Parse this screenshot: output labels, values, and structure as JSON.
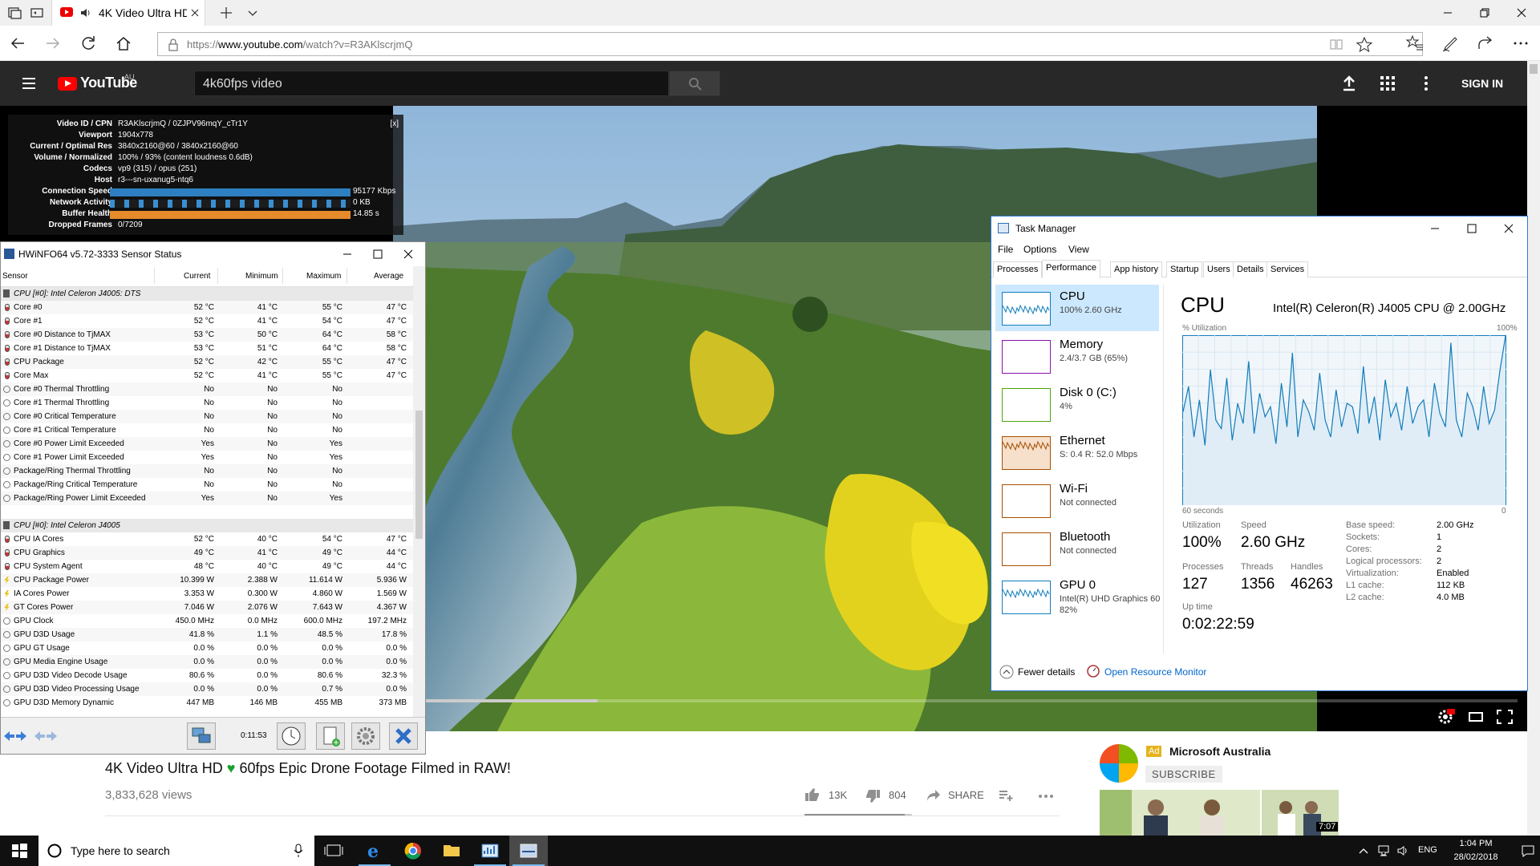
{
  "browser": {
    "tab_title": "4K Video Ultra HD ·",
    "url_prefix": "https://",
    "url_domain": "www.youtube.com",
    "url_path": "/watch?v=R3AKlscrjmQ"
  },
  "youtube": {
    "logo": "YouTube",
    "region": "AU",
    "search_value": "4k60fps video",
    "sign_in": "SIGN IN",
    "video_title_1": "4K Video Ultra HD",
    "video_title_heart": "♥",
    "video_title_2": "60fps Epic Drone Footage Filmed in RAW!",
    "views": "3,833,628 views",
    "likes": "13K",
    "dislikes": "804",
    "share": "SHARE",
    "ad_badge": "Ad",
    "ad_channel": "Microsoft Australia",
    "subscribe": "SUBSCRIBE",
    "thumb_duration": "7:07",
    "watched_fraction": 0.003,
    "buffered_fraction": 0.39
  },
  "nerd_stats": {
    "close": "[x]",
    "rows": [
      {
        "key": "Video ID / CPN",
        "value": "R3AKlscrjmQ / 0ZJPV96mqY_cTr1Y"
      },
      {
        "key": "Viewport",
        "value": "1904x778"
      },
      {
        "key": "Current / Optimal Res",
        "value": "3840x2160@60 / 3840x2160@60"
      },
      {
        "key": "Volume / Normalized",
        "value": "100% / 93% (content loudness 0.6dB)"
      },
      {
        "key": "Codecs",
        "value": "vp9 (315) / opus (251)"
      },
      {
        "key": "Host",
        "value": "r3---sn-uxanug5-ntq6"
      },
      {
        "key": "Connection Speed",
        "value": "95177 Kbps"
      },
      {
        "key": "Network Activity",
        "value": "0 KB"
      },
      {
        "key": "Buffer Health",
        "value": "14.85 s"
      },
      {
        "key": "Dropped Frames",
        "value": "0/7209"
      }
    ]
  },
  "hwinfo": {
    "title": "HWiNFO64 v5.72-3333 Sensor Status",
    "columns": [
      "Sensor",
      "Current",
      "Minimum",
      "Maximum",
      "Average"
    ],
    "rows": [
      {
        "type": "grp",
        "name": "CPU [#0]: Intel Celeron J4005: DTS"
      },
      {
        "type": "therm",
        "name": "Core #0",
        "cur": "52 °C",
        "min": "41 °C",
        "max": "55 °C",
        "avg": "47 °C"
      },
      {
        "type": "therm",
        "name": "Core #1",
        "cur": "52 °C",
        "min": "41 °C",
        "max": "54 °C",
        "avg": "47 °C"
      },
      {
        "type": "therm",
        "name": "Core #0 Distance to TjMAX",
        "cur": "53 °C",
        "min": "50 °C",
        "max": "64 °C",
        "avg": "58 °C"
      },
      {
        "type": "therm",
        "name": "Core #1 Distance to TjMAX",
        "cur": "53 °C",
        "min": "51 °C",
        "max": "64 °C",
        "avg": "58 °C"
      },
      {
        "type": "therm",
        "name": "CPU Package",
        "cur": "52 °C",
        "min": "42 °C",
        "max": "55 °C",
        "avg": "47 °C"
      },
      {
        "type": "therm",
        "name": "Core Max",
        "cur": "52 °C",
        "min": "41 °C",
        "max": "55 °C",
        "avg": "47 °C"
      },
      {
        "type": "clock",
        "name": "Core #0 Thermal Throttling",
        "cur": "No",
        "min": "No",
        "max": "No",
        "avg": ""
      },
      {
        "type": "clock",
        "name": "Core #1 Thermal Throttling",
        "cur": "No",
        "min": "No",
        "max": "No",
        "avg": ""
      },
      {
        "type": "clock",
        "name": "Core #0 Critical Temperature",
        "cur": "No",
        "min": "No",
        "max": "No",
        "avg": ""
      },
      {
        "type": "clock",
        "name": "Core #1 Critical Temperature",
        "cur": "No",
        "min": "No",
        "max": "No",
        "avg": ""
      },
      {
        "type": "clock",
        "name": "Core #0 Power Limit Exceeded",
        "cur": "Yes",
        "min": "No",
        "max": "Yes",
        "avg": ""
      },
      {
        "type": "clock",
        "name": "Core #1 Power Limit Exceeded",
        "cur": "Yes",
        "min": "No",
        "max": "Yes",
        "avg": ""
      },
      {
        "type": "clock",
        "name": "Package/Ring Thermal Throttling",
        "cur": "No",
        "min": "No",
        "max": "No",
        "avg": ""
      },
      {
        "type": "clock",
        "name": "Package/Ring Critical Temperature",
        "cur": "No",
        "min": "No",
        "max": "No",
        "avg": ""
      },
      {
        "type": "clock",
        "name": "Package/Ring Power Limit Exceeded",
        "cur": "Yes",
        "min": "No",
        "max": "Yes",
        "avg": ""
      },
      {
        "type": "blank",
        "name": ""
      },
      {
        "type": "grp",
        "name": "CPU [#0]: Intel Celeron J4005"
      },
      {
        "type": "therm",
        "name": "CPU IA Cores",
        "cur": "52 °C",
        "min": "40 °C",
        "max": "54 °C",
        "avg": "47 °C"
      },
      {
        "type": "therm",
        "name": "CPU Graphics",
        "cur": "49 °C",
        "min": "41 °C",
        "max": "49 °C",
        "avg": "44 °C"
      },
      {
        "type": "therm",
        "name": "CPU System Agent",
        "cur": "48 °C",
        "min": "40 °C",
        "max": "49 °C",
        "avg": "44 °C"
      },
      {
        "type": "bolt",
        "name": "CPU Package Power",
        "cur": "10.399 W",
        "min": "2.388 W",
        "max": "11.614 W",
        "avg": "5.936 W"
      },
      {
        "type": "bolt",
        "name": "IA Cores Power",
        "cur": "3.353 W",
        "min": "0.300 W",
        "max": "4.860 W",
        "avg": "1.569 W"
      },
      {
        "type": "bolt",
        "name": "GT Cores Power",
        "cur": "7.046 W",
        "min": "2.076 W",
        "max": "7.643 W",
        "avg": "4.367 W"
      },
      {
        "type": "clock",
        "name": "GPU Clock",
        "cur": "450.0 MHz",
        "min": "0.0 MHz",
        "max": "600.0 MHz",
        "avg": "197.2 MHz"
      },
      {
        "type": "clock",
        "name": "GPU D3D Usage",
        "cur": "41.8 %",
        "min": "1.1 %",
        "max": "48.5 %",
        "avg": "17.8 %"
      },
      {
        "type": "clock",
        "name": "GPU GT Usage",
        "cur": "0.0 %",
        "min": "0.0 %",
        "max": "0.0 %",
        "avg": "0.0 %"
      },
      {
        "type": "clock",
        "name": "GPU Media Engine Usage",
        "cur": "0.0 %",
        "min": "0.0 %",
        "max": "0.0 %",
        "avg": "0.0 %"
      },
      {
        "type": "clock",
        "name": "GPU D3D Video Decode Usage",
        "cur": "80.6 %",
        "min": "0.0 %",
        "max": "80.6 %",
        "avg": "32.3 %"
      },
      {
        "type": "clock",
        "name": "GPU D3D Video Processing Usage",
        "cur": "0.0 %",
        "min": "0.0 %",
        "max": "0.7 %",
        "avg": "0.0 %"
      },
      {
        "type": "clock",
        "name": "GPU D3D Memory Dynamic",
        "cur": "447 MB",
        "min": "146 MB",
        "max": "455 MB",
        "avg": "373 MB"
      }
    ],
    "timer": "0:11:53"
  },
  "taskmgr": {
    "title": "Task Manager",
    "menu": [
      "File",
      "Options",
      "View"
    ],
    "tabs": [
      "Processes",
      "Performance",
      "App history",
      "Startup",
      "Users",
      "Details",
      "Services"
    ],
    "resources": [
      {
        "name": "CPU",
        "val": "100%  2.60 GHz",
        "val2": "",
        "color": "#117dbb"
      },
      {
        "name": "Memory",
        "val": "2.4/3.7 GB (65%)",
        "val2": "",
        "color": "#8b12ae"
      },
      {
        "name": "Disk 0 (C:)",
        "val": "4%",
        "val2": "",
        "color": "#4da60c"
      },
      {
        "name": "Ethernet",
        "val": "S: 0.4  R: 52.0 Mbps",
        "val2": "",
        "color": "#a74f01"
      },
      {
        "name": "Wi-Fi",
        "val": "Not connected",
        "val2": "",
        "color": "#a74f01"
      },
      {
        "name": "Bluetooth",
        "val": "Not connected",
        "val2": "",
        "color": "#a74f01"
      },
      {
        "name": "GPU 0",
        "val": "Intel(R) UHD Graphics 60",
        "val2": "82%",
        "color": "#117dbb"
      }
    ],
    "cpu_heading": "CPU",
    "cpu_model": "Intel(R) Celeron(R) J4005 CPU @ 2.00GHz",
    "util_label": "% Utilization",
    "util_max": "100%",
    "seconds_label": "60 seconds",
    "zero_label": "0",
    "stats": {
      "utilization_label": "Utilization",
      "utilization": "100%",
      "speed_label": "Speed",
      "speed": "2.60 GHz",
      "processes_label": "Processes",
      "processes": "127",
      "threads_label": "Threads",
      "threads": "1356",
      "handles_label": "Handles",
      "handles": "46263",
      "uptime_label": "Up time",
      "uptime": "0:02:22:59"
    },
    "props": [
      {
        "k": "Base speed:",
        "v": "2.00 GHz"
      },
      {
        "k": "Sockets:",
        "v": "1"
      },
      {
        "k": "Cores:",
        "v": "2"
      },
      {
        "k": "Logical processors:",
        "v": "2"
      },
      {
        "k": "Virtualization:",
        "v": "Enabled"
      },
      {
        "k": "L1 cache:",
        "v": "112 KB"
      },
      {
        "k": "L2 cache:",
        "v": "4.0 MB"
      }
    ],
    "cpu_history_percent": [
      55,
      70,
      40,
      62,
      35,
      80,
      50,
      45,
      75,
      38,
      60,
      48,
      85,
      42,
      66,
      52,
      58,
      36,
      72,
      46,
      90,
      40,
      62,
      55,
      44,
      78,
      50,
      40,
      68,
      46,
      60,
      58,
      42,
      82,
      48,
      64,
      38,
      74,
      52,
      60,
      44,
      70,
      48,
      58,
      62,
      40,
      72,
      54,
      46,
      96,
      50,
      40,
      66,
      58,
      44,
      70,
      48,
      56,
      80,
      100
    ],
    "fewer_details": "Fewer details",
    "open_resource_monitor": "Open Resource Monitor"
  },
  "taskbar": {
    "search_placeholder": "Type here to search",
    "lang": "ENG",
    "time": "1:04 PM",
    "date": "28/02/2018"
  }
}
